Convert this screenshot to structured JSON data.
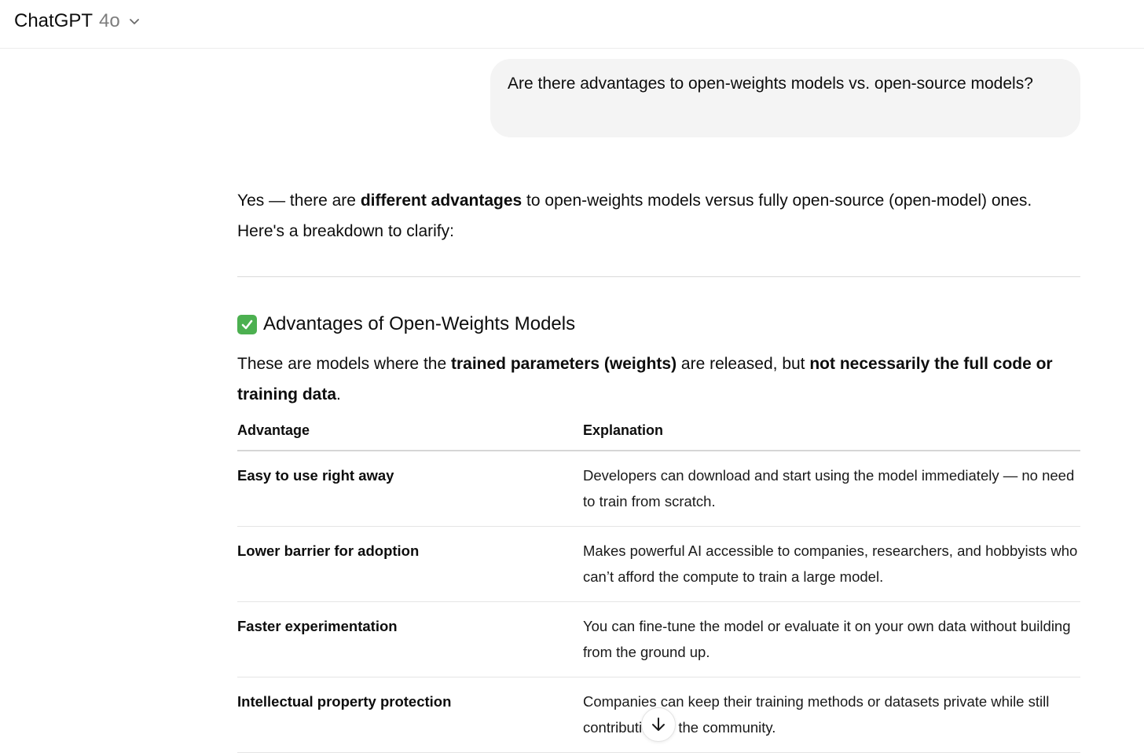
{
  "header": {
    "model_name": "ChatGPT",
    "model_version": "4o"
  },
  "user_message": "Are there advantages to open-weights models vs. open-source models?",
  "assistant": {
    "intro": {
      "pre": "Yes — there are ",
      "bold": "different advantages",
      "post": " to open-weights models versus fully open-source (open-model) ones. Here's a breakdown to clarify:"
    },
    "section": {
      "title": "Advantages of Open-Weights Models",
      "icon": "check-mark-button-icon",
      "desc_pre": "These are models where the ",
      "desc_bold1": "trained parameters (weights)",
      "desc_mid": " are released, but ",
      "desc_bold2": "not necessarily the full code or training data",
      "desc_post": "."
    },
    "table": {
      "headers": [
        "Advantage",
        "Explanation"
      ],
      "rows": [
        {
          "advantage": "Easy to use right away",
          "explanation": "Developers can download and start using the model immediately — no need to train from scratch."
        },
        {
          "advantage": "Lower barrier for adoption",
          "explanation": "Makes powerful AI accessible to companies, researchers, and hobbyists who can’t afford the compute to train a large model."
        },
        {
          "advantage": "Faster experimentation",
          "explanation": "You can fine-tune the model or evaluate it on your own data without building from the ground up."
        },
        {
          "advantage": "Intellectual property protection",
          "explanation": "Companies can keep their training methods or datasets private while still contributing to the community."
        }
      ]
    }
  },
  "colors": {
    "check_icon_bg": "#4cb050",
    "bubble_bg": "#f4f4f4"
  }
}
